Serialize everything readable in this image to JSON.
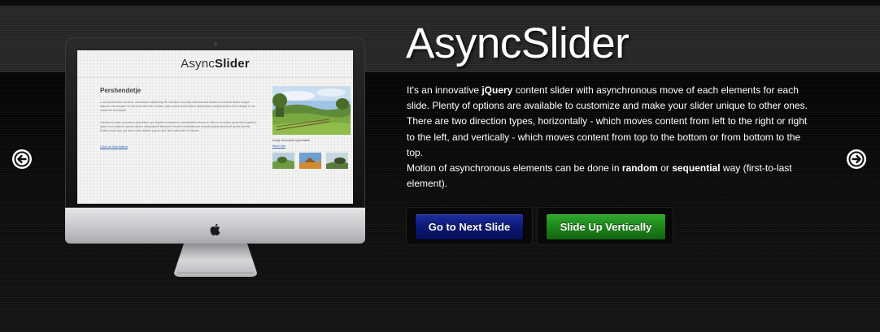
{
  "slide": {
    "title": "AsyncSlider",
    "description": {
      "p1_pre": "It's an innovative ",
      "p1_bold": "jQuery",
      "p1_post": " content slider with asynchronous move of each elements for each slide. Plenty of options are available to customize and make your slider unique to other ones.",
      "p2": "There are two direction types, horizontally - which moves content from left to the right or right to the left, and vertically - which moves content from top to the bottom or from bottom to the top.",
      "p3_pre": "Motion of asynchronous elements can be done in ",
      "p3_bold1": "random",
      "p3_mid": " or ",
      "p3_bold2": "sequential",
      "p3_post": " way (first-to-last element)."
    },
    "buttons": {
      "next": "Go to Next Slide",
      "vertical": "Slide Up Vertically"
    }
  },
  "preview_screen": {
    "logo_light": "Async",
    "logo_bold": "Slider",
    "heading": "Pershendetje",
    "paragraph1": "Lorem ipsum dolor sit amet, consectetur adipisicing elit, sed diam non-umy nibh euismod tincidunt ut laoreet dolore magna aliquam erat volutpat. Ut wisi enim ad minim veniam, quis nostrud exerci tation ullamcorper suscipit lobortis nisl ut aliquip ex ea commodo consequat.",
    "paragraph2": "Claritas est etiam processus dynamicus, qui sequitur mutationem consuetudium lectorum. Mirum est notare quam littera gothica, quam nunc putamus parum claram, anteposuerit litterarum formas humanitatis per seacula quarta decima et quinta decima. Eodem modo typi, qui nunc nobis videntur parum clari, fiant sollemnes in futurum.",
    "link": "Click on this button",
    "image_caption_pre": "Image description goes ",
    "image_caption_bold": "here",
    "more_link": "More info"
  },
  "icons": {
    "prev": "arrow-left-circle-icon",
    "next": "arrow-right-circle-icon",
    "apple": "apple-logo-icon"
  },
  "colors": {
    "button_blue": "#0b1670",
    "button_green": "#1c8119",
    "background": "#101010"
  }
}
